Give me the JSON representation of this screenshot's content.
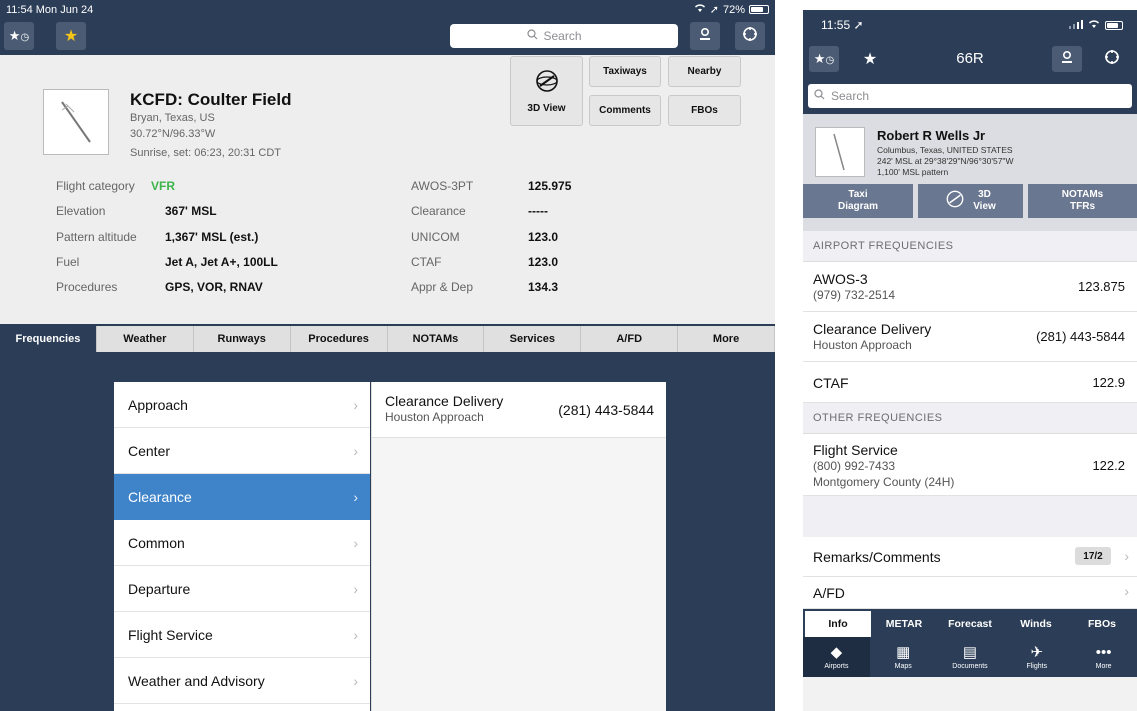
{
  "ipad": {
    "status": {
      "time_date": "11:54  Mon Jun 24",
      "battery": "72%",
      "battery_level": 0.72
    },
    "search": {
      "placeholder": "Search"
    },
    "airport": {
      "title": "KCFD: Coulter Field",
      "location": "Bryan, Texas, US",
      "coords": "30.72°N/96.33°W",
      "sun": "Sunrise, set: 06:23, 20:31 CDT"
    },
    "buttons": {
      "view3d": "3D View",
      "taxiways": "Taxiways",
      "nearby": "Nearby",
      "comments": "Comments",
      "fbos": "FBOs"
    },
    "info_left": [
      {
        "label": "Flight category",
        "value": "VFR"
      },
      {
        "label": "Elevation",
        "value": "367' MSL"
      },
      {
        "label": "Pattern altitude",
        "value": "1,367' MSL (est.)"
      },
      {
        "label": "Fuel",
        "value": "Jet A, Jet A+, 100LL"
      },
      {
        "label": "Procedures",
        "value": "GPS, VOR, RNAV"
      }
    ],
    "info_right": [
      {
        "label": "AWOS-3PT",
        "value": "125.975"
      },
      {
        "label": "Clearance",
        "value": "-----"
      },
      {
        "label": "UNICOM",
        "value": "123.0"
      },
      {
        "label": "CTAF",
        "value": "123.0"
      },
      {
        "label": "Appr & Dep",
        "value": "134.3"
      }
    ],
    "tabs": [
      "Frequencies",
      "Weather",
      "Runways",
      "Procedures",
      "NOTAMs",
      "Services",
      "A/FD",
      "More"
    ],
    "freq_categories": [
      "Approach",
      "Center",
      "Clearance",
      "Common",
      "Departure",
      "Flight Service",
      "Weather and Advisory"
    ],
    "detail": {
      "title": "Clearance Delivery",
      "subtitle": "Houston Approach",
      "phone": "(281) 443-5844"
    },
    "colors": {
      "nav": "#2c3e57",
      "vfr": "#3cb44a",
      "selected": "#3f83c9"
    }
  },
  "phone": {
    "status": {
      "time": "11:55"
    },
    "nav_title": "66R",
    "search": {
      "placeholder": "Search"
    },
    "airport": {
      "name": "Robert R Wells Jr",
      "location": "Columbus, Texas, UNITED STATES",
      "line2": "242' MSL at 29°38'29\"N/96°30'57\"W",
      "line3": "1,100' MSL pattern"
    },
    "buttons": {
      "taxi": [
        "Taxi",
        "Diagram"
      ],
      "view3d": [
        "3D",
        "View"
      ],
      "notams": [
        "NOTAMs",
        "TFRs"
      ]
    },
    "sections": {
      "airport_freq": "AIRPORT FREQUENCIES",
      "other_freq": "OTHER FREQUENCIES"
    },
    "airport_freqs": [
      {
        "title": "AWOS-3",
        "sub": "(979) 732-2514",
        "value": "123.875"
      },
      {
        "title": "Clearance Delivery",
        "sub": "Houston Approach",
        "value": "(281) 443-5844"
      },
      {
        "title": "CTAF",
        "sub": "",
        "value": "122.9"
      }
    ],
    "other_freqs": [
      {
        "title": "Flight Service",
        "sub": "(800) 992-7433",
        "sub2": "Montgomery County (24H)",
        "value": "122.2"
      }
    ],
    "remarks": {
      "label": "Remarks/Comments",
      "badge": "17/2"
    },
    "afd": "A/FD",
    "segment_tabs": [
      "Info",
      "METAR",
      "Forecast",
      "Winds",
      "FBOs"
    ],
    "tabbar": [
      "Airports",
      "Maps",
      "Documents",
      "Flights",
      "More"
    ]
  }
}
